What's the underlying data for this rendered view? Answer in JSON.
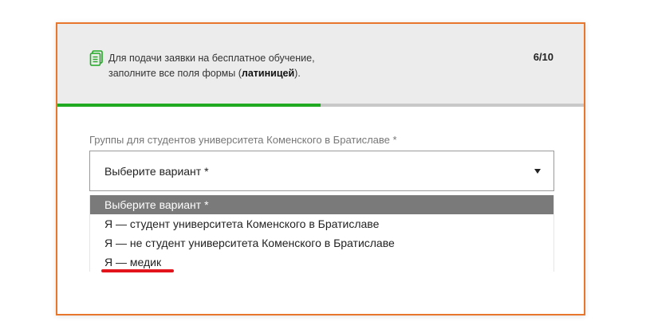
{
  "header": {
    "notice_line1": "Для подачи заявки на бесплатное обучение,",
    "notice_line2_prefix": "заполните все поля формы (",
    "notice_line2_bold": "латиницей",
    "notice_line2_suffix": ").",
    "step": "6/10",
    "icon": "document-icon"
  },
  "progress": {
    "fraction": 0.5
  },
  "colors": {
    "accent_border": "#e8762c",
    "progress": "#1faa22",
    "selected_option": "#7a7a7a",
    "annotation": "#e3141b"
  },
  "field": {
    "label": "Группы для студентов университета Коменского в Братиславе *",
    "value": "Выберите вариант *",
    "options": [
      "Выберите вариант *",
      "Я — студент университета Коменского в Братиславе",
      "Я — не студент университета Коменского в Братиславе",
      "Я — медик"
    ]
  }
}
